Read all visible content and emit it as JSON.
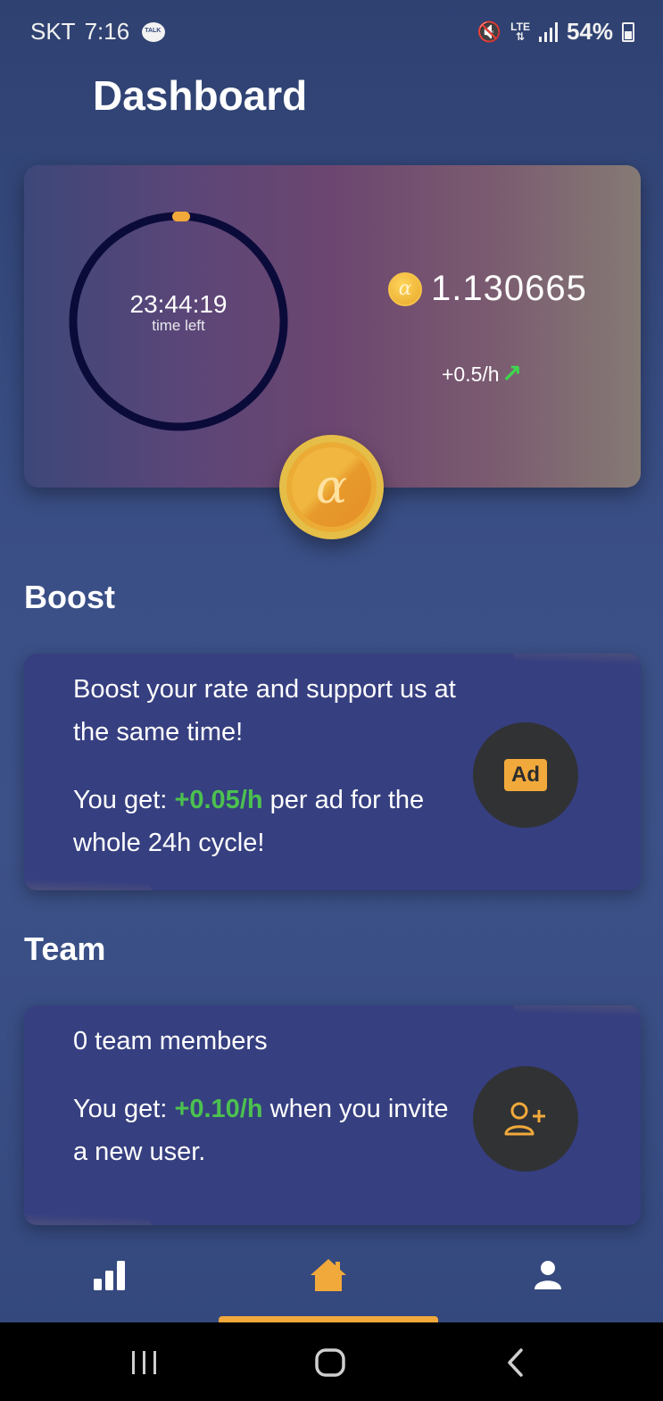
{
  "status_bar": {
    "carrier": "SKT",
    "time": "7:16",
    "network": "LTE",
    "battery": "54%"
  },
  "page_title": "Dashboard",
  "timer_card": {
    "time_left_value": "23:44:19",
    "time_left_label": "time left",
    "balance": "1.130665",
    "rate": "+0.5/h",
    "coin_symbol": "α"
  },
  "boost": {
    "title": "Boost",
    "line1": "Boost your rate and support us at the same time!",
    "line2_prefix": "You get: ",
    "line2_highlight": "+0.05/h",
    "line2_suffix": " per ad for the whole 24h cycle!",
    "button_label": "Ad"
  },
  "team": {
    "title": "Team",
    "members": "0 team members",
    "line2_prefix": "You get: ",
    "line2_highlight": "+0.10/h",
    "line2_suffix": " when you invite a new user."
  },
  "bottom_nav": {
    "items": [
      {
        "icon": "chart-bars-icon"
      },
      {
        "icon": "home-icon",
        "active": true
      },
      {
        "icon": "user-icon"
      }
    ]
  },
  "colors": {
    "accent": "#f2a93b",
    "highlight_green": "#4cc14f",
    "card_blue": "#363f80",
    "ring": "#0b0b3a"
  }
}
